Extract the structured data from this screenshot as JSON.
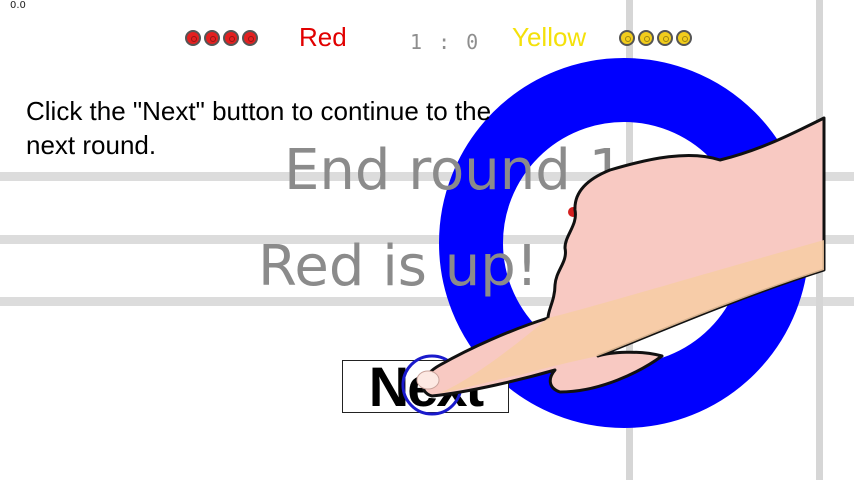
{
  "hud": {
    "fps": "0.0",
    "red_team": "Red",
    "yellow_team": "Yellow",
    "score": "1 : 0",
    "red_stones_remaining": 4,
    "yellow_stones_remaining": 4
  },
  "tutorial": {
    "instruction": "Click the \"Next\" button to continue to the next round.",
    "pointer": "hand-pointer-icon"
  },
  "round": {
    "end_text": "End round 1",
    "turn_text": "Red is up!"
  },
  "controls": {
    "next_label": "Next"
  },
  "colors": {
    "red": "#e10000",
    "yellow": "#f4e10a",
    "house_ring": "#0000ff",
    "message_text": "#8b8b8b"
  }
}
